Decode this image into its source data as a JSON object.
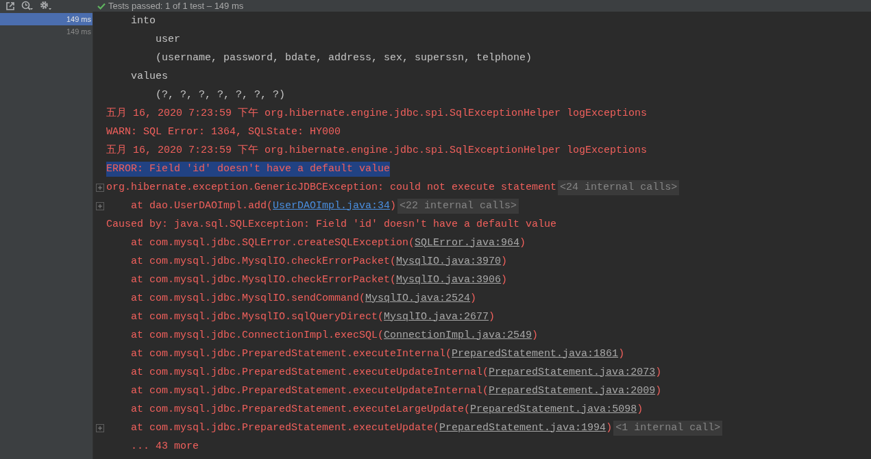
{
  "toolbar": {
    "status": {
      "passed": true,
      "text": "Tests passed: 1 of 1 test – 149 ms"
    }
  },
  "sidebar": {
    "items": [
      {
        "duration": "149 ms",
        "selected": true
      },
      {
        "duration": "149 ms",
        "selected": false
      }
    ]
  },
  "console": {
    "lines": [
      {
        "kind": "sql-clause",
        "text": "into",
        "fold_marker": false,
        "selected": false
      },
      {
        "kind": "sql-value",
        "text": "user",
        "fold_marker": false,
        "selected": false
      },
      {
        "kind": "sql-value",
        "text": "(username, password, bdate, address, sex, superssn, telphone)",
        "fold_marker": false,
        "selected": false
      },
      {
        "kind": "sql-clause",
        "text": "values",
        "fold_marker": false,
        "selected": false
      },
      {
        "kind": "sql-value",
        "text": "(?, ?, ?, ?, ?, ?, ?)",
        "fold_marker": false,
        "selected": false
      },
      {
        "kind": "log",
        "text": "五月 16, 2020 7:23:59 下午 org.hibernate.engine.jdbc.spi.SqlExceptionHelper logExceptions",
        "fold_marker": false,
        "selected": false
      },
      {
        "kind": "log",
        "text": "WARN: SQL Error: 1364, SQLState: HY000",
        "fold_marker": false,
        "selected": false
      },
      {
        "kind": "log",
        "text": "五月 16, 2020 7:23:59 下午 org.hibernate.engine.jdbc.spi.SqlExceptionHelper logExceptions",
        "fold_marker": false,
        "selected": false
      },
      {
        "kind": "log",
        "text": "ERROR: Field 'id' doesn't have a default value",
        "fold_marker": false,
        "selected": true
      },
      {
        "kind": "log",
        "text": "org.hibernate.exception.GenericJDBCException: could not execute statement",
        "folded_calls": "<24 internal calls>",
        "fold_marker": true,
        "selected": false
      },
      {
        "kind": "frame",
        "text": "at dao.UserDAOImpl.add(",
        "link": {
          "kind": "project",
          "text": "UserDAOImpl.java:34"
        },
        "after": ")",
        "folded_calls": "<22 internal calls>",
        "fold_marker": true,
        "selected": false
      },
      {
        "kind": "log",
        "text": "Caused by: java.sql.SQLException: Field 'id' doesn't have a default value",
        "fold_marker": false,
        "selected": false
      },
      {
        "kind": "frame",
        "text": "at com.mysql.jdbc.SQLError.createSQLException(",
        "link": {
          "kind": "library",
          "text": "SQLError.java:964"
        },
        "after": ")",
        "fold_marker": false,
        "selected": false
      },
      {
        "kind": "frame",
        "text": "at com.mysql.jdbc.MysqlIO.checkErrorPacket(",
        "link": {
          "kind": "library",
          "text": "MysqlIO.java:3970"
        },
        "after": ")",
        "fold_marker": false,
        "selected": false
      },
      {
        "kind": "frame",
        "text": "at com.mysql.jdbc.MysqlIO.checkErrorPacket(",
        "link": {
          "kind": "library",
          "text": "MysqlIO.java:3906"
        },
        "after": ")",
        "fold_marker": false,
        "selected": false
      },
      {
        "kind": "frame",
        "text": "at com.mysql.jdbc.MysqlIO.sendCommand(",
        "link": {
          "kind": "library",
          "text": "MysqlIO.java:2524"
        },
        "after": ")",
        "fold_marker": false,
        "selected": false
      },
      {
        "kind": "frame",
        "text": "at com.mysql.jdbc.MysqlIO.sqlQueryDirect(",
        "link": {
          "kind": "library",
          "text": "MysqlIO.java:2677"
        },
        "after": ")",
        "fold_marker": false,
        "selected": false
      },
      {
        "kind": "frame",
        "text": "at com.mysql.jdbc.ConnectionImpl.execSQL(",
        "link": {
          "kind": "library",
          "text": "ConnectionImpl.java:2549"
        },
        "after": ")",
        "fold_marker": false,
        "selected": false
      },
      {
        "kind": "frame",
        "text": "at com.mysql.jdbc.PreparedStatement.executeInternal(",
        "link": {
          "kind": "library",
          "text": "PreparedStatement.java:1861"
        },
        "after": ")",
        "fold_marker": false,
        "selected": false
      },
      {
        "kind": "frame",
        "text": "at com.mysql.jdbc.PreparedStatement.executeUpdateInternal(",
        "link": {
          "kind": "library",
          "text": "PreparedStatement.java:2073"
        },
        "after": ")",
        "fold_marker": false,
        "selected": false
      },
      {
        "kind": "frame",
        "text": "at com.mysql.jdbc.PreparedStatement.executeUpdateInternal(",
        "link": {
          "kind": "library",
          "text": "PreparedStatement.java:2009"
        },
        "after": ")",
        "fold_marker": false,
        "selected": false
      },
      {
        "kind": "frame",
        "text": "at com.mysql.jdbc.PreparedStatement.executeLargeUpdate(",
        "link": {
          "kind": "library",
          "text": "PreparedStatement.java:5098"
        },
        "after": ")",
        "fold_marker": false,
        "selected": false
      },
      {
        "kind": "frame",
        "text": "at com.mysql.jdbc.PreparedStatement.executeUpdate(",
        "link": {
          "kind": "library",
          "text": "PreparedStatement.java:1994"
        },
        "after": ")",
        "folded_calls": "<1 internal call>",
        "fold_marker": true,
        "selected": false
      },
      {
        "kind": "frame",
        "text": "... 43 more",
        "fold_marker": false,
        "selected": false
      }
    ]
  }
}
